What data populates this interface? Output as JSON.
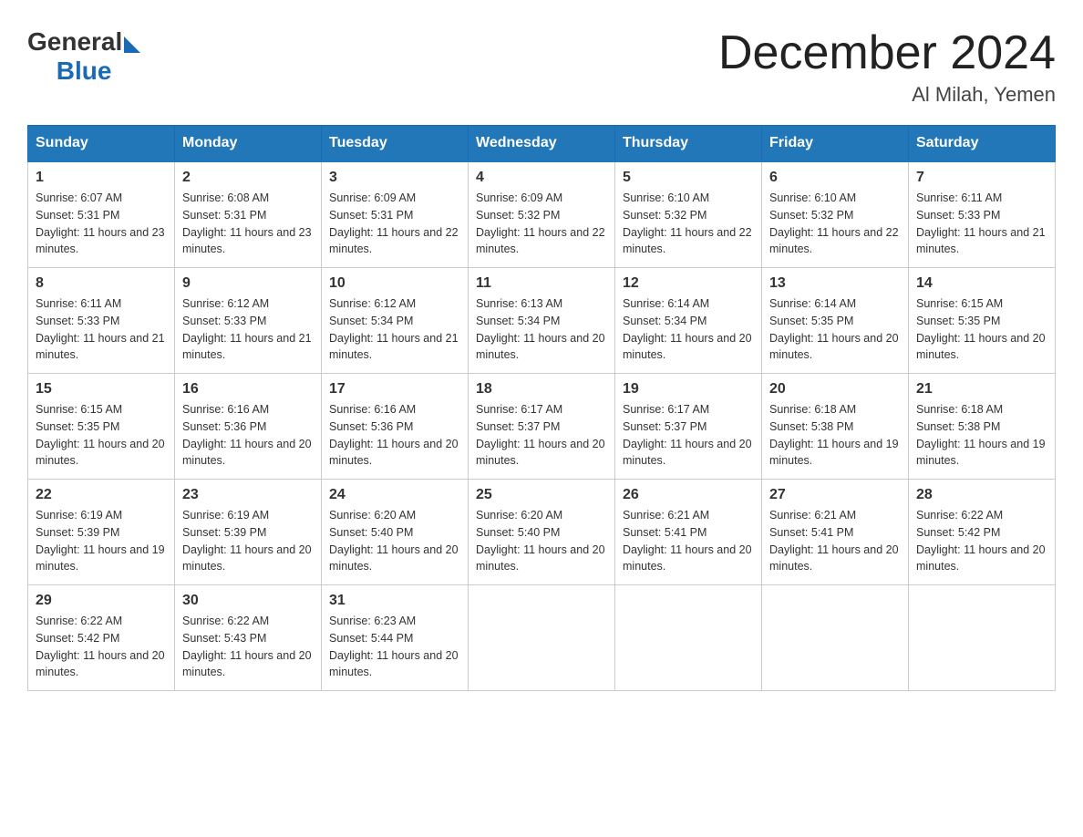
{
  "header": {
    "logo_general": "General",
    "logo_blue": "Blue",
    "title": "December 2024",
    "subtitle": "Al Milah, Yemen"
  },
  "columns": [
    "Sunday",
    "Monday",
    "Tuesday",
    "Wednesday",
    "Thursday",
    "Friday",
    "Saturday"
  ],
  "weeks": [
    [
      {
        "day": "1",
        "sunrise": "Sunrise: 6:07 AM",
        "sunset": "Sunset: 5:31 PM",
        "daylight": "Daylight: 11 hours and 23 minutes."
      },
      {
        "day": "2",
        "sunrise": "Sunrise: 6:08 AM",
        "sunset": "Sunset: 5:31 PM",
        "daylight": "Daylight: 11 hours and 23 minutes."
      },
      {
        "day": "3",
        "sunrise": "Sunrise: 6:09 AM",
        "sunset": "Sunset: 5:31 PM",
        "daylight": "Daylight: 11 hours and 22 minutes."
      },
      {
        "day": "4",
        "sunrise": "Sunrise: 6:09 AM",
        "sunset": "Sunset: 5:32 PM",
        "daylight": "Daylight: 11 hours and 22 minutes."
      },
      {
        "day": "5",
        "sunrise": "Sunrise: 6:10 AM",
        "sunset": "Sunset: 5:32 PM",
        "daylight": "Daylight: 11 hours and 22 minutes."
      },
      {
        "day": "6",
        "sunrise": "Sunrise: 6:10 AM",
        "sunset": "Sunset: 5:32 PM",
        "daylight": "Daylight: 11 hours and 22 minutes."
      },
      {
        "day": "7",
        "sunrise": "Sunrise: 6:11 AM",
        "sunset": "Sunset: 5:33 PM",
        "daylight": "Daylight: 11 hours and 21 minutes."
      }
    ],
    [
      {
        "day": "8",
        "sunrise": "Sunrise: 6:11 AM",
        "sunset": "Sunset: 5:33 PM",
        "daylight": "Daylight: 11 hours and 21 minutes."
      },
      {
        "day": "9",
        "sunrise": "Sunrise: 6:12 AM",
        "sunset": "Sunset: 5:33 PM",
        "daylight": "Daylight: 11 hours and 21 minutes."
      },
      {
        "day": "10",
        "sunrise": "Sunrise: 6:12 AM",
        "sunset": "Sunset: 5:34 PM",
        "daylight": "Daylight: 11 hours and 21 minutes."
      },
      {
        "day": "11",
        "sunrise": "Sunrise: 6:13 AM",
        "sunset": "Sunset: 5:34 PM",
        "daylight": "Daylight: 11 hours and 20 minutes."
      },
      {
        "day": "12",
        "sunrise": "Sunrise: 6:14 AM",
        "sunset": "Sunset: 5:34 PM",
        "daylight": "Daylight: 11 hours and 20 minutes."
      },
      {
        "day": "13",
        "sunrise": "Sunrise: 6:14 AM",
        "sunset": "Sunset: 5:35 PM",
        "daylight": "Daylight: 11 hours and 20 minutes."
      },
      {
        "day": "14",
        "sunrise": "Sunrise: 6:15 AM",
        "sunset": "Sunset: 5:35 PM",
        "daylight": "Daylight: 11 hours and 20 minutes."
      }
    ],
    [
      {
        "day": "15",
        "sunrise": "Sunrise: 6:15 AM",
        "sunset": "Sunset: 5:35 PM",
        "daylight": "Daylight: 11 hours and 20 minutes."
      },
      {
        "day": "16",
        "sunrise": "Sunrise: 6:16 AM",
        "sunset": "Sunset: 5:36 PM",
        "daylight": "Daylight: 11 hours and 20 minutes."
      },
      {
        "day": "17",
        "sunrise": "Sunrise: 6:16 AM",
        "sunset": "Sunset: 5:36 PM",
        "daylight": "Daylight: 11 hours and 20 minutes."
      },
      {
        "day": "18",
        "sunrise": "Sunrise: 6:17 AM",
        "sunset": "Sunset: 5:37 PM",
        "daylight": "Daylight: 11 hours and 20 minutes."
      },
      {
        "day": "19",
        "sunrise": "Sunrise: 6:17 AM",
        "sunset": "Sunset: 5:37 PM",
        "daylight": "Daylight: 11 hours and 20 minutes."
      },
      {
        "day": "20",
        "sunrise": "Sunrise: 6:18 AM",
        "sunset": "Sunset: 5:38 PM",
        "daylight": "Daylight: 11 hours and 19 minutes."
      },
      {
        "day": "21",
        "sunrise": "Sunrise: 6:18 AM",
        "sunset": "Sunset: 5:38 PM",
        "daylight": "Daylight: 11 hours and 19 minutes."
      }
    ],
    [
      {
        "day": "22",
        "sunrise": "Sunrise: 6:19 AM",
        "sunset": "Sunset: 5:39 PM",
        "daylight": "Daylight: 11 hours and 19 minutes."
      },
      {
        "day": "23",
        "sunrise": "Sunrise: 6:19 AM",
        "sunset": "Sunset: 5:39 PM",
        "daylight": "Daylight: 11 hours and 20 minutes."
      },
      {
        "day": "24",
        "sunrise": "Sunrise: 6:20 AM",
        "sunset": "Sunset: 5:40 PM",
        "daylight": "Daylight: 11 hours and 20 minutes."
      },
      {
        "day": "25",
        "sunrise": "Sunrise: 6:20 AM",
        "sunset": "Sunset: 5:40 PM",
        "daylight": "Daylight: 11 hours and 20 minutes."
      },
      {
        "day": "26",
        "sunrise": "Sunrise: 6:21 AM",
        "sunset": "Sunset: 5:41 PM",
        "daylight": "Daylight: 11 hours and 20 minutes."
      },
      {
        "day": "27",
        "sunrise": "Sunrise: 6:21 AM",
        "sunset": "Sunset: 5:41 PM",
        "daylight": "Daylight: 11 hours and 20 minutes."
      },
      {
        "day": "28",
        "sunrise": "Sunrise: 6:22 AM",
        "sunset": "Sunset: 5:42 PM",
        "daylight": "Daylight: 11 hours and 20 minutes."
      }
    ],
    [
      {
        "day": "29",
        "sunrise": "Sunrise: 6:22 AM",
        "sunset": "Sunset: 5:42 PM",
        "daylight": "Daylight: 11 hours and 20 minutes."
      },
      {
        "day": "30",
        "sunrise": "Sunrise: 6:22 AM",
        "sunset": "Sunset: 5:43 PM",
        "daylight": "Daylight: 11 hours and 20 minutes."
      },
      {
        "day": "31",
        "sunrise": "Sunrise: 6:23 AM",
        "sunset": "Sunset: 5:44 PM",
        "daylight": "Daylight: 11 hours and 20 minutes."
      },
      null,
      null,
      null,
      null
    ]
  ]
}
